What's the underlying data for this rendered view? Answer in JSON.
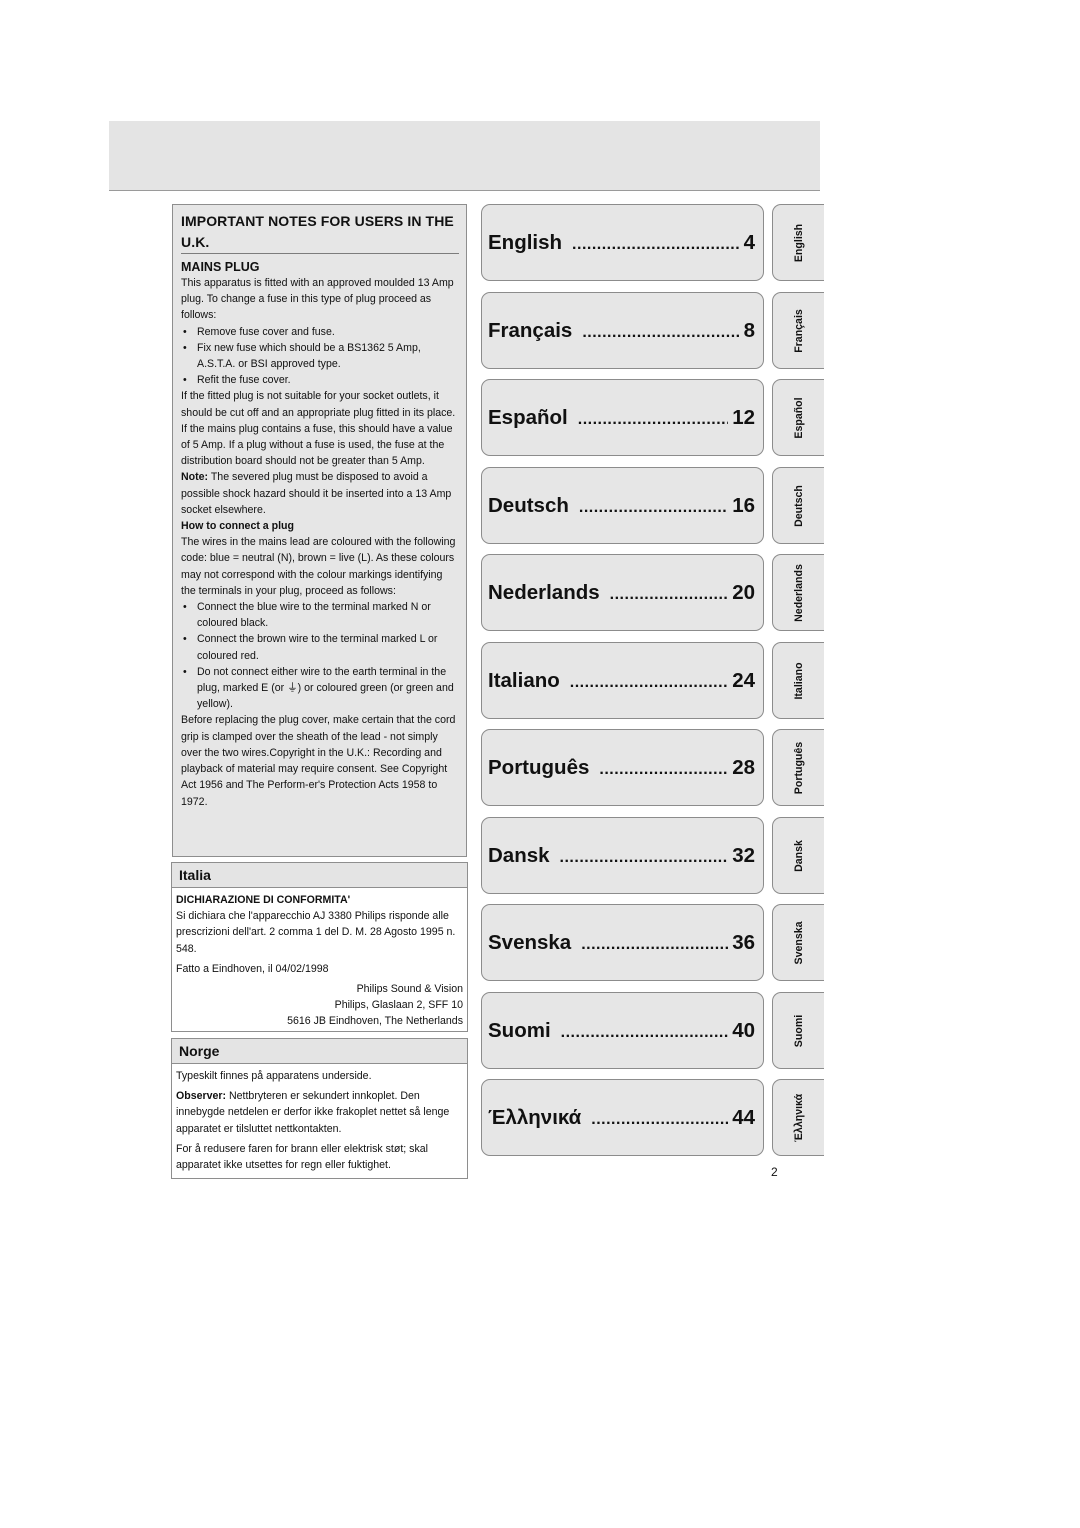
{
  "uk_notes": {
    "title": "IMPORTANT NOTES FOR USERS IN THE U.K.",
    "mains_plug_heading": "MAINS PLUG",
    "intro": "This apparatus is fitted with an approved moulded 13 Amp plug. To change a fuse in this type of plug proceed as follows:",
    "fuse_steps": [
      "Remove fuse cover and fuse.",
      "Fix new fuse which should be a BS1362 5 Amp, A.S.T.A. or BSI approved type.",
      "Refit the fuse cover."
    ],
    "unsuitable_plug": "If the fitted plug is not suitable for your socket outlets, it should be cut off and an appropriate plug fitted in its place. If the mains plug contains a fuse, this should have a value of 5 Amp. If a plug without a fuse is used, the fuse at the distribution board should not be greater than 5 Amp.",
    "note_label": "Note:",
    "note_text": " The severed plug must be disposed to avoid a possible shock hazard should it be inserted into a 13 Amp socket elsewhere.",
    "how_to_heading": "How to connect a plug",
    "wires_text": "The wires in the mains lead are coloured with the following code: blue = neutral (N), brown = live (L). As these colours may not correspond with the colour markings identifying the terminals in your plug, proceed as follows:",
    "connect_steps": [
      "Connect the blue wire to the terminal marked N or coloured black.",
      "Connect the brown wire to the terminal marked L or coloured red.",
      "Do not connect either wire to the earth terminal in the plug, marked E (or ⏚) or coloured green (or green and yellow)."
    ],
    "closing_text": "Before replacing the plug cover, make certain that the cord grip is clamped over the sheath of the lead - not simply over the two wires.Copyright in the U.K.: Recording and playback of material may require consent. See Copyright Act 1956 and The Perform-er's Protection Acts 1958 to 1972."
  },
  "italia": {
    "heading": "Italia",
    "subheading": "DICHIARAZIONE DI CONFORMITA'",
    "text": "Si dichiara che l'apparecchio AJ 3380 Philips risponde alle prescrizioni dell'art. 2 comma 1 del D. M. 28 Agosto 1995 n. 548.",
    "place_date": "Fatto a Eindhoven, il 04/02/1998",
    "address_lines": [
      "Philips Sound & Vision",
      "Philips, Glaslaan 2, SFF 10",
      "5616 JB Eindhoven, The Netherlands"
    ]
  },
  "norge": {
    "heading": "Norge",
    "line1": "Typeskilt finnes på apparatens underside.",
    "observer_label": "Observer:",
    "observer_text": " Nettbryteren er sekundert innkoplet. Den innebygde netdelen er derfor ikke frakoplet nettet så lenge apparatet er tilsluttet nettkontakten.",
    "line3": "For å redusere faren for brann eller elektrisk støt; skal apparatet ikke utsettes for regn eller fuktighet."
  },
  "toc": [
    {
      "lang": "English",
      "page": "4",
      "tab": "English"
    },
    {
      "lang": "Français",
      "page": "8",
      "tab": "Français"
    },
    {
      "lang": "Español",
      "page": "12",
      "tab": "Español"
    },
    {
      "lang": "Deutsch",
      "page": "16",
      "tab": "Deutsch"
    },
    {
      "lang": "Nederlands",
      "page": "20",
      "tab": "Nederlands"
    },
    {
      "lang": "Italiano",
      "page": "24",
      "tab": "Italiano"
    },
    {
      "lang": "Português",
      "page": "28",
      "tab": "Português"
    },
    {
      "lang": "Dansk",
      "page": "32",
      "tab": "Dansk"
    },
    {
      "lang": "Svenska",
      "page": "36",
      "tab": "Svenska"
    },
    {
      "lang": "Suomi",
      "page": "40",
      "tab": "Suomi"
    },
    {
      "lang": "Έλληνικά",
      "page": "44",
      "tab": "Έλληνικά"
    }
  ],
  "toc_leader": "......................................................",
  "page_number": "2"
}
